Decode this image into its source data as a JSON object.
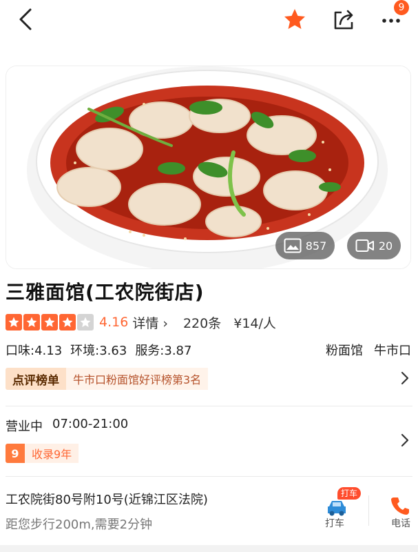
{
  "topbar": {
    "back_icon": "chevron-left-icon",
    "favorite_icon": "star-icon",
    "share_icon": "share-icon",
    "more_icon": "more-dots-icon",
    "notification_count": "9",
    "accent_color": "#ff5a1f"
  },
  "hero": {
    "photo_count": "857",
    "video_count": "20"
  },
  "shop": {
    "name": "三雅面馆(工农院街店)",
    "rating": 4.16,
    "rating_text": "4.16",
    "stars_filled": 4,
    "stars_total": 5,
    "detail_label": "详情",
    "review_count": "220条",
    "price": "¥14/人",
    "scores": [
      "口味:4.13",
      "环境:3.63",
      "服务:3.87"
    ],
    "category": "粉面馆",
    "area": "牛市口"
  },
  "ranking": {
    "tag": "点评榜单",
    "text": "牛市口粉面馆好评榜第3名"
  },
  "hours": {
    "status": "营业中",
    "time": "07:00-21:00",
    "years_num": "9",
    "years_text": "收录9年"
  },
  "address": {
    "line": "工农院街80号附10号(近锦江区法院)",
    "distance": "距您步行200m,需要2分钟",
    "taxi_badge": "打车",
    "taxi_label": "打车",
    "phone_label": "电话"
  }
}
